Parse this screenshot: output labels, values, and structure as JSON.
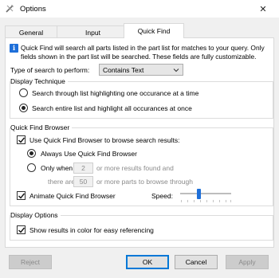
{
  "window": {
    "title": "Options",
    "app_icon": "options-app-icon",
    "close_symbol": "✕"
  },
  "tabs": [
    {
      "label": "General"
    },
    {
      "label": "Input"
    },
    {
      "label": "Quick Find",
      "active": true
    }
  ],
  "info": {
    "icon": "info-icon",
    "icon_glyph": "i",
    "text": "Quick Find will search all parts listed in the part list for matches to your query.  Only fields shown in the part list will be searched.  These fields are fully customizable."
  },
  "search_type": {
    "label": "Type of search to perform:",
    "value": "Contains Text"
  },
  "display_technique": {
    "title": "Display Technique",
    "options": [
      {
        "label": "Search through list highlighting one occurance at a time",
        "selected": false
      },
      {
        "label": "Search entire list and highlight all occurances at once",
        "selected": true
      }
    ]
  },
  "quick_find_browser": {
    "title": "Quick Find Browser",
    "use_browser": {
      "label": "Use Quick Find Browser to browse search results:",
      "checked": true
    },
    "always": {
      "label": "Always Use Quick Find Browser",
      "selected": true
    },
    "only_when": {
      "label": "Only when",
      "count": "2",
      "after_count": "or more results found and",
      "there_are": "there are",
      "parts": "50",
      "after_parts": "or more parts to browse through",
      "selected": false
    },
    "animate": {
      "label": "Animate Quick Find Browser",
      "checked": true
    },
    "speed": {
      "label": "Speed:",
      "level": 0.35
    }
  },
  "display_options": {
    "title": "Display Options",
    "color_results": {
      "label": "Show results in color for easy referencing",
      "checked": true
    }
  },
  "buttons": {
    "reject": "Reject",
    "ok": "OK",
    "cancel": "Cancel",
    "apply": "Apply"
  },
  "colors": {
    "accent": "#1e6fd9",
    "disabled_text": "#8a8a8a",
    "default_border": "#0078d7"
  }
}
